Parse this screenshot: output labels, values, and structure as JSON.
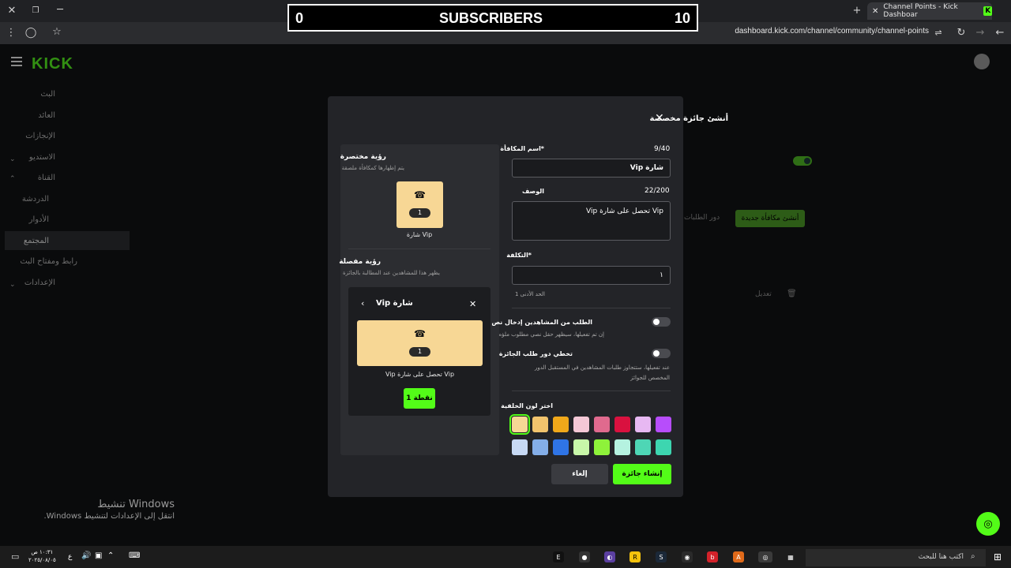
{
  "overlay": {
    "left_value": "0",
    "title": "SUBSCRIBERS",
    "right_value": "10"
  },
  "browser": {
    "tab_title": "Channel Points - Kick Dashboar",
    "url": "dashboard.kick.com/channel/community/channel-points"
  },
  "sidebar": {
    "logo": "KICK",
    "items": [
      {
        "label": "البث"
      },
      {
        "label": "العائد"
      },
      {
        "label": "الإنجازات"
      },
      {
        "label": "الاستديو"
      },
      {
        "label": "القناة"
      },
      {
        "label": "الدردشة"
      },
      {
        "label": "الأدوار"
      },
      {
        "label": "المجتمع"
      },
      {
        "label": "رابط ومفتاح البث"
      },
      {
        "label": "الإعدادات"
      }
    ]
  },
  "background": {
    "new_reward_button": "أنشئ مكافأة جديدة",
    "queue_link": "دور الطلبات",
    "edit_button": "تعديل"
  },
  "modal": {
    "title": "أنشئ جائزة مخصصة",
    "preview": {
      "compact_title": "رؤية مختصرة",
      "compact_sub": "يتم إظهارها كمكافأة ملصقة",
      "card_count": "1",
      "card_name": "شارة Vip",
      "detail_title": "رؤية مفصلة",
      "detail_sub": "يظهر هذا للمشاهدين عند المطالبة بالجائزة",
      "detail_header": "شارة Vip",
      "detail_desc": "Vip تحصل على شارة Vip",
      "points_button": "1 نقطة"
    },
    "form": {
      "name_label": "*اسم المكافأة",
      "name_count": "9/40",
      "name_value": "شارة Vip",
      "desc_label": "الوصف",
      "desc_count": "22/200",
      "desc_value": "Vip تحصل على شارة Vip",
      "cost_label": "*التكلفة",
      "cost_value": "١",
      "cost_hint": "الحد الأدنى 1",
      "text_toggle_label": "الطلب من المشاهدين إدخال نص",
      "text_toggle_hint": "إن تم تفعيلها، سيظهر حقل نصي مطلوب ملؤه",
      "skip_toggle_label": "تخطي دور طلب الجائزة",
      "skip_toggle_hint": "عند تفعيلها، ستتجاوز طلبات المشاهدين في المستقبل الدور المخصص للجوائز",
      "color_label": "اختر لون الخلفية",
      "colors": [
        "#f7d795",
        "#f2c46d",
        "#f0a81a",
        "#f4c8d6",
        "#e06a8e",
        "#d9113f",
        "#e7b8f2",
        "#b74dfb",
        "#c7d9f4",
        "#84aee8",
        "#2f74e6",
        "#c8f7a9",
        "#8ef23a",
        "#b5f2e0",
        "#4ed6b5",
        "#3dd6b0"
      ],
      "cancel_button": "إلغاء",
      "create_button": "إنشاء جائزة"
    }
  },
  "watermark": {
    "line1": "تنشيط Windows",
    "line2": "انتقل إلى الإعدادات لتنشيط Windows."
  },
  "taskbar": {
    "search_placeholder": "اكتب هنا للبحث",
    "time": "١٠:٣١ ص",
    "date": "٢٠٢٥/٠٨/٠٥",
    "lang": "ع"
  }
}
